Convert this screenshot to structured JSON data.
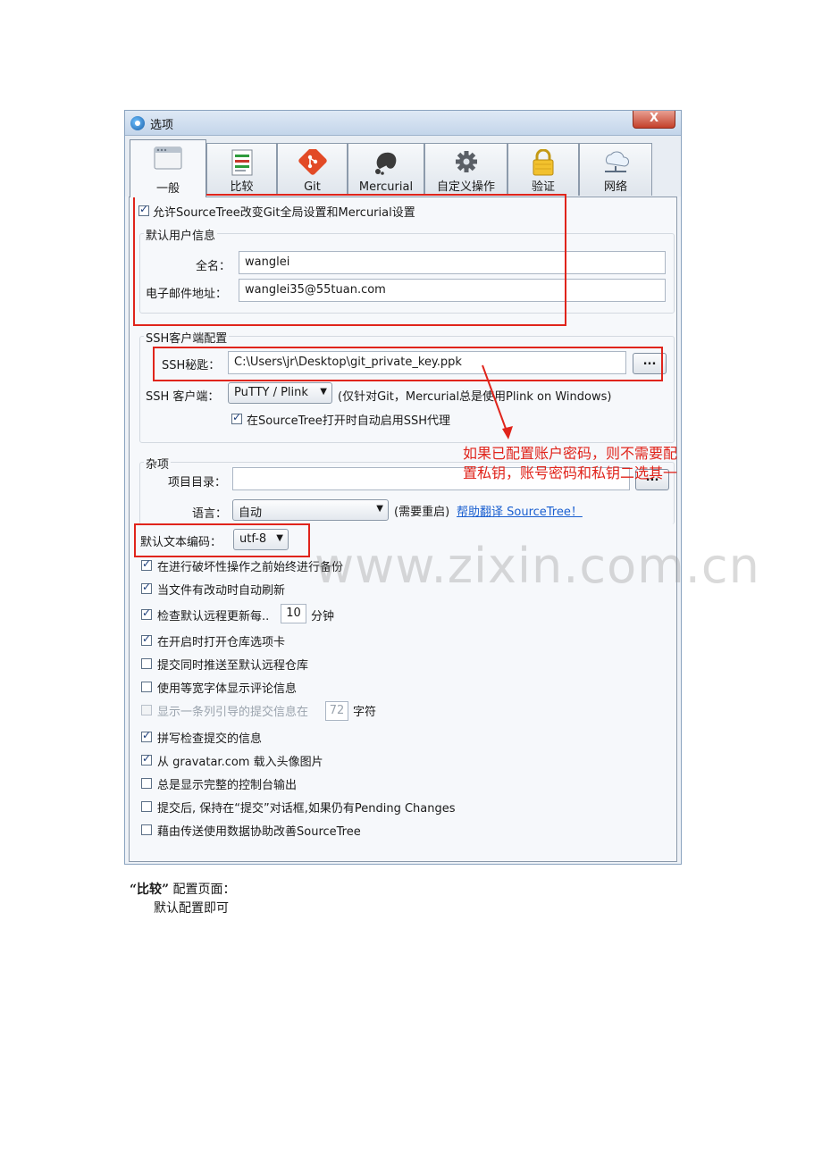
{
  "window": {
    "title": "选项",
    "close_label": "X"
  },
  "tabs": [
    {
      "label": "一般",
      "icon": "window-icon"
    },
    {
      "label": "比较",
      "icon": "diff-icon"
    },
    {
      "label": "Git",
      "icon": "git-icon"
    },
    {
      "label": "Mercurial",
      "icon": "mercurial-icon"
    },
    {
      "label": "自定义操作",
      "icon": "gear-icon"
    },
    {
      "label": "验证",
      "icon": "lock-icon"
    },
    {
      "label": "网络",
      "icon": "cloud-network-icon"
    }
  ],
  "general": {
    "allow_global_label": "允许SourceTree改变Git全局设置和Mercurial设置",
    "allow_global_checked": true,
    "user_group_title": "默认用户信息",
    "fullname_label": "全名：",
    "fullname_value": "wanglei",
    "email_label": "电子邮件地址：",
    "email_value": "wanglei35@55tuan.com"
  },
  "ssh": {
    "group_title": "SSH客户端配置",
    "key_label": "SSH秘匙：",
    "key_value": "C:\\Users\\jr\\Desktop\\git_private_key.ppk",
    "browse_label": "...",
    "client_label": "SSH 客户端：",
    "client_value": "PuTTY / Plink",
    "client_note": "(仅针对Git，Mercurial总是使用Plink on Windows)",
    "agent_label": "在SourceTree打开时自动启用SSH代理",
    "agent_checked": true
  },
  "misc": {
    "group_title": "杂项",
    "project_dir_label": "项目目录：",
    "project_dir_value": "",
    "browse_label": "...",
    "language_label": "语言：",
    "language_value": "自动",
    "restart_note": "(需要重启)",
    "translate_link": "帮助翻译 SourceTree！",
    "encoding_label": "默认文本编码：",
    "encoding_value": "utf-8"
  },
  "options": [
    {
      "label": "在进行破坏性操作之前始终进行备份",
      "checked": true
    },
    {
      "label": "当文件有改动时自动刷新",
      "checked": true
    },
    {
      "label": "检查默认远程更新每..",
      "checked": true,
      "value": "10",
      "suffix": "分钟"
    },
    {
      "label": "在开启时打开仓库选项卡",
      "checked": true
    },
    {
      "label": "提交同时推送至默认远程仓库",
      "checked": false
    },
    {
      "label": "使用等宽字体显示评论信息",
      "checked": false
    },
    {
      "label": "显示一条列引导的提交信息在",
      "checked": false,
      "disabled": true,
      "value": "72",
      "suffix": "字符"
    },
    {
      "label": "拼写检查提交的信息",
      "checked": true
    },
    {
      "label": "从 gravatar.com 载入头像图片",
      "checked": true
    },
    {
      "label": "总是显示完整的控制台输出",
      "checked": false
    },
    {
      "label": "提交后, 保持在“提交”对话框,如果仍有Pending Changes",
      "checked": false
    },
    {
      "label": "藉由传送使用数据协助改善SourceTree",
      "checked": false
    }
  ],
  "annotation": {
    "text": "如果已配置账户密码，则不需要配置私钥，账号密码和私钥二选其一"
  },
  "watermark": "www.zixin.com.cn",
  "doc": {
    "heading_quote": "“比较”",
    "heading_rest": " 配置页面：",
    "body": "默认配置即可"
  },
  "colors": {
    "annotation_red": "#e0241b",
    "link_blue": "#1a5fd0"
  }
}
